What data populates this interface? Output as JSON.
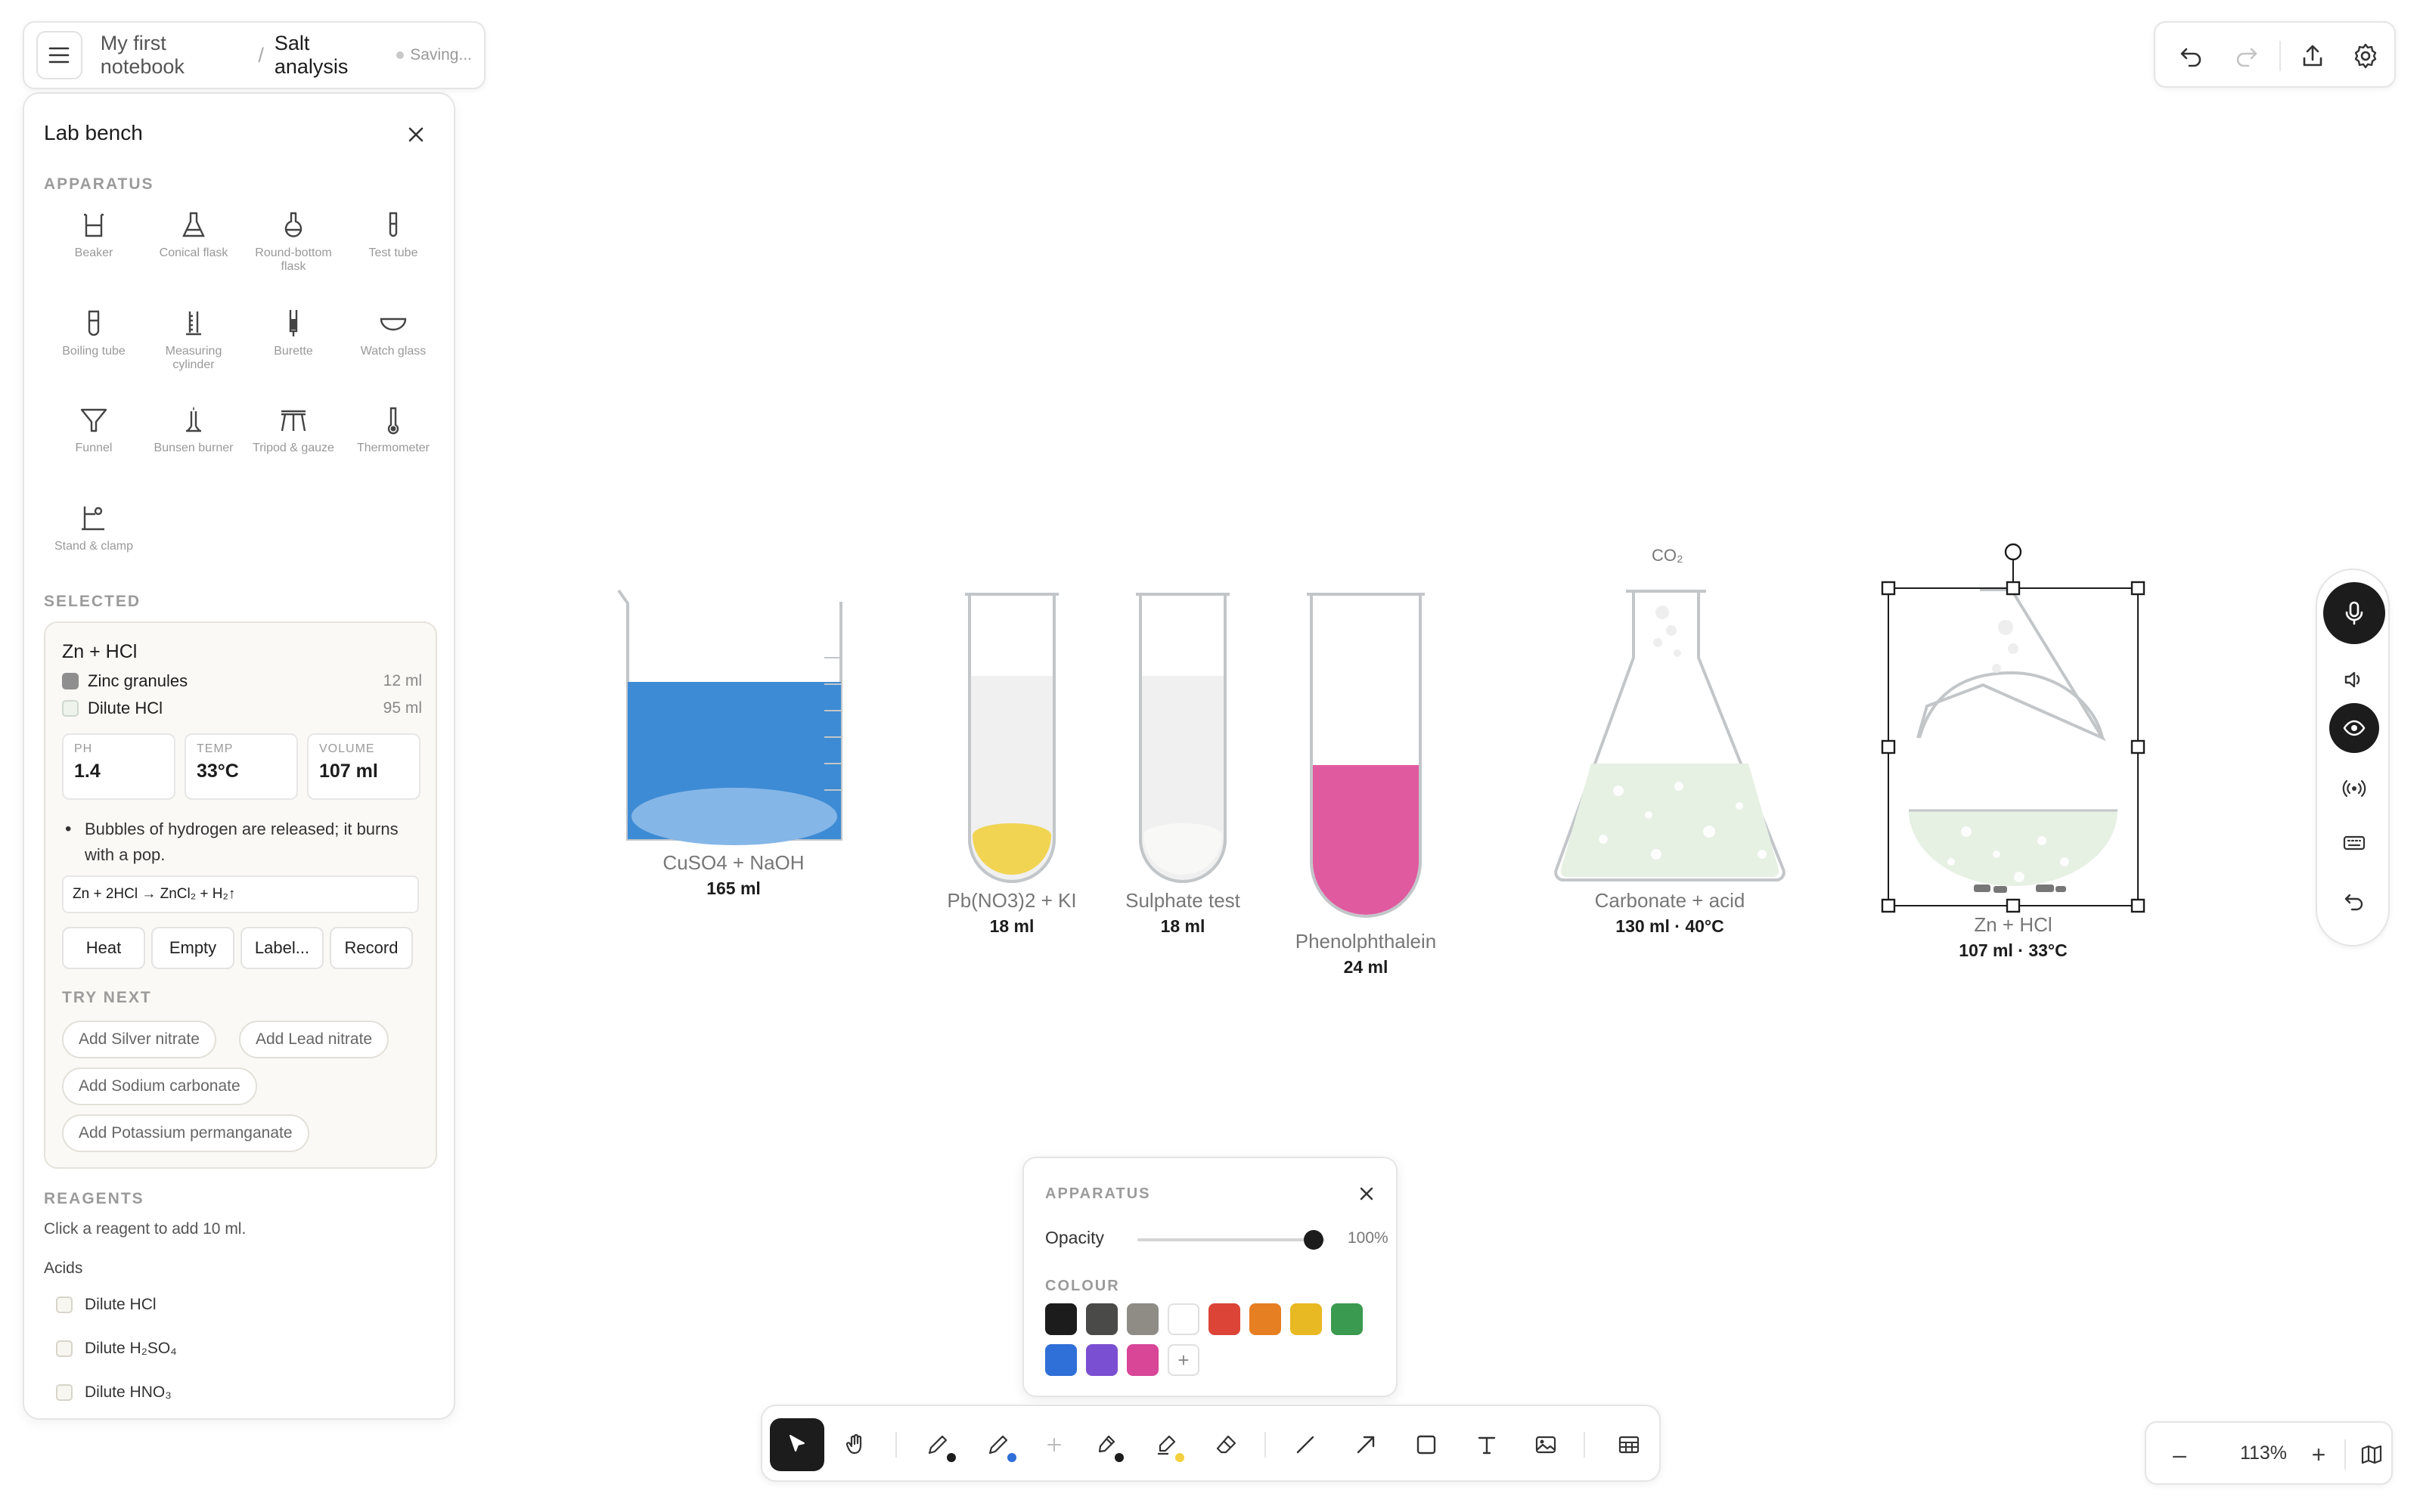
{
  "header": {
    "notebook": "My first notebook",
    "separator": "/",
    "page": "Salt analysis",
    "status": "Saving..."
  },
  "panel": {
    "title": "Lab bench",
    "apparatus_label": "APPARATUS",
    "apparatus": [
      {
        "label": "Beaker",
        "icon": "beaker-icon"
      },
      {
        "label": "Conical flask",
        "icon": "conical-flask-icon"
      },
      {
        "label": "Round-bottom flask",
        "icon": "round-bottom-flask-icon"
      },
      {
        "label": "Test tube",
        "icon": "test-tube-icon"
      },
      {
        "label": "Boiling tube",
        "icon": "boiling-tube-icon"
      },
      {
        "label": "Measuring cylinder",
        "icon": "measuring-cylinder-icon"
      },
      {
        "label": "Burette",
        "icon": "burette-icon"
      },
      {
        "label": "Watch glass",
        "icon": "watch-glass-icon"
      },
      {
        "label": "Funnel",
        "icon": "funnel-icon"
      },
      {
        "label": "Bunsen burner",
        "icon": "bunsen-burner-icon"
      },
      {
        "label": "Tripod & gauze",
        "icon": "tripod-icon"
      },
      {
        "label": "Thermometer",
        "icon": "thermometer-icon"
      },
      {
        "label": "Stand & clamp",
        "icon": "stand-clamp-icon"
      }
    ],
    "selected_label": "SELECTED",
    "selected": {
      "title": "Zn + HCl",
      "ingredients": [
        {
          "name": "Zinc granules",
          "amount": "12 ml",
          "color": "#8f8f8f"
        },
        {
          "name": "Dilute HCl",
          "amount": "95 ml",
          "color": "#eef4ec"
        }
      ],
      "stats": [
        {
          "key": "PH",
          "value": "1.4"
        },
        {
          "key": "TEMP",
          "value": "33°C"
        },
        {
          "key": "VOLUME",
          "value": "107 ml"
        }
      ],
      "observation": "Bubbles of hydrogen are released; it burns with a pop.",
      "equation": "Zn + 2HCl → ZnCl₂ + H₂↑",
      "actions": [
        "Heat",
        "Empty",
        "Label...",
        "Record"
      ],
      "try_next_label": "TRY NEXT",
      "try_next": [
        "Add Silver nitrate",
        "Add Lead nitrate",
        "Add Sodium carbonate",
        "Add Potassium permanganate"
      ]
    },
    "reagents_label": "REAGENTS",
    "reagents_hint": "Click a reagent to add 10 ml.",
    "acids_label": "Acids",
    "acids": [
      "Dilute HCl",
      "Dilute H₂SO₄",
      "Dilute HNO₃"
    ]
  },
  "canvas": {
    "items": [
      {
        "name": "CuSO4 + NaOH",
        "meta": "165 ml",
        "color": "#3d8bd4"
      },
      {
        "name": "Pb(NO3)2 + KI",
        "meta": "18 ml",
        "color": "#f1d451"
      },
      {
        "name": "Sulphate test",
        "meta": "18 ml",
        "color": "#f3f3f1"
      },
      {
        "name": "Phenolphthalein",
        "meta": "24 ml",
        "color": "#e05aa0"
      },
      {
        "name": "Carbonate + acid",
        "meta": "130 ml  ·  40°C",
        "color": "#e6f0e3",
        "gas": "CO₂"
      },
      {
        "name": "Zn + HCl",
        "meta": "107 ml  ·  33°C",
        "color": "#e6f0e3"
      }
    ]
  },
  "top_right": {
    "buttons": [
      "undo-icon",
      "redo-icon",
      "export-icon",
      "settings-icon"
    ]
  },
  "right_toolbar": {
    "buttons": [
      "microphone-icon",
      "speaker-icon",
      "eye-icon",
      "broadcast-icon",
      "keyboard-icon",
      "reset-icon"
    ]
  },
  "popup": {
    "title": "APPARATUS",
    "opacity_label": "Opacity",
    "opacity_value": "100%",
    "opacity": 1.0,
    "colour_label": "COLOUR",
    "colours": [
      "#1c1c1c",
      "#4a4a48",
      "#8f8c86",
      "#ffffff",
      "#db4437",
      "#e67e22",
      "#e8b923",
      "#3a9a4f",
      "#2f6fd8",
      "#7b4fd1",
      "#d94597"
    ],
    "add_label": "+"
  },
  "bottom_toolbar": {
    "tools": [
      "select-icon",
      "hand-icon",
      "pencil-icon",
      "pen-icon",
      "add-icon",
      "marker-icon",
      "highlighter-icon",
      "eraser-icon",
      "line-icon",
      "arrow-icon",
      "rectangle-icon",
      "text-icon",
      "image-icon",
      "table-icon"
    ],
    "active": "select-icon"
  },
  "zoom": {
    "minus": "–",
    "value": "113%",
    "plus": "+"
  }
}
